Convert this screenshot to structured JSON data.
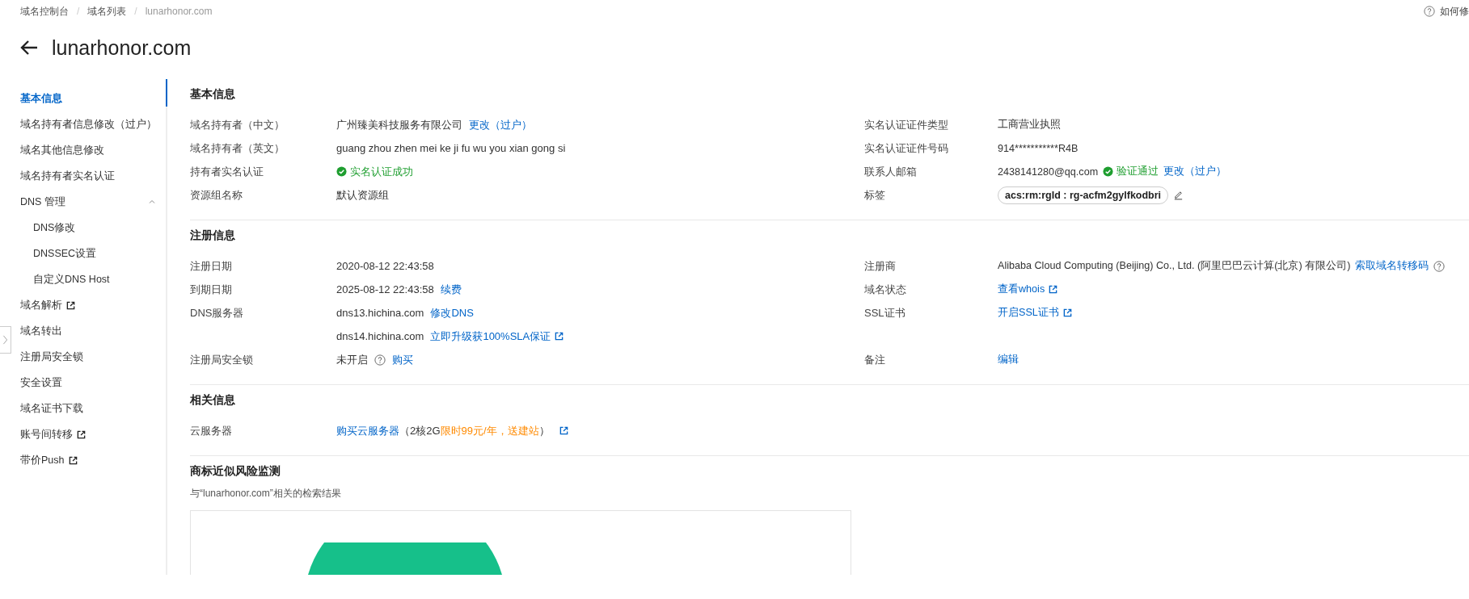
{
  "breadcrumb": [
    {
      "label": "域名控制台",
      "current": false
    },
    {
      "separator": "/",
      "label": "域名列表",
      "current": false
    },
    {
      "separator": "/",
      "label": "lunarhonor.com",
      "current": true
    }
  ],
  "help_link": "如何修",
  "title": "lunarhonor.com",
  "sidebar": {
    "items": [
      {
        "label": "基本信息",
        "selected": true
      },
      {
        "label": "域名持有者信息修改（过户）",
        "selected": false
      },
      {
        "label": "域名其他信息修改",
        "selected": false
      },
      {
        "label": "域名持有者实名认证",
        "selected": false
      },
      {
        "label": "DNS 管理",
        "selected": false,
        "expanded": true,
        "children": [
          {
            "label": "DNS修改",
            "selected": false
          },
          {
            "label": "DNSSEC设置",
            "selected": false
          },
          {
            "label": "自定义DNS Host",
            "selected": false
          }
        ]
      },
      {
        "label": "域名解析",
        "selected": false,
        "external": true
      },
      {
        "label": "域名转出",
        "selected": false
      },
      {
        "label": "注册局安全锁",
        "selected": false
      },
      {
        "label": "安全设置",
        "selected": false
      },
      {
        "label": "域名证书下载",
        "selected": false
      },
      {
        "label": "账号间转移",
        "selected": false,
        "external": true
      },
      {
        "label": "带价Push",
        "selected": false,
        "external": true
      }
    ]
  },
  "sections": [
    {
      "title": "基本信息",
      "rows": [
        {
          "left": {
            "label": "域名持有者（中文）",
            "lines": [
              [
                {
                  "kind": "text",
                  "text": "广州臻美科技服务有限公司"
                },
                {
                  "kind": "link",
                  "text": "更改（过户）"
                }
              ]
            ]
          },
          "right": {
            "label": "实名认证证件类型",
            "lines": [
              [
                {
                  "kind": "text",
                  "text": "工商营业执照"
                }
              ]
            ]
          }
        },
        {
          "left": {
            "label": "域名持有者（英文）",
            "lines": [
              [
                {
                  "kind": "text",
                  "text": "guang zhou zhen mei ke ji fu wu you xian gong si"
                }
              ]
            ]
          },
          "right": {
            "label": "实名认证证件号码",
            "lines": [
              [
                {
                  "kind": "text",
                  "text": "914***********R4B"
                }
              ]
            ]
          }
        },
        {
          "left": {
            "label": "持有者实名认证",
            "lines": [
              [
                {
                  "kind": "success",
                  "text": "实名认证成功"
                }
              ]
            ]
          },
          "right": {
            "label": "联系人邮箱",
            "lines": [
              [
                {
                  "kind": "text",
                  "text": "2438141280@qq.com"
                },
                {
                  "kind": "success",
                  "text": "验证通过"
                },
                {
                  "kind": "link",
                  "text": "更改（过户）"
                }
              ]
            ]
          }
        },
        {
          "left": {
            "label": "资源组名称",
            "lines": [
              [
                {
                  "kind": "text",
                  "text": "默认资源组"
                }
              ]
            ]
          },
          "right": {
            "label": "标签",
            "lines": [
              [
                {
                  "kind": "tag",
                  "text": "acs:rm:rgId : rg-acfm2gylfkodbri"
                },
                {
                  "kind": "edit"
                }
              ]
            ]
          }
        }
      ]
    },
    {
      "title": "注册信息",
      "rows": [
        {
          "left": {
            "label": "注册日期",
            "lines": [
              [
                {
                  "kind": "text",
                  "text": "2020-08-12 22:43:58"
                }
              ]
            ]
          },
          "right": {
            "label": "注册商",
            "lines": [
              [
                {
                  "kind": "text",
                  "text": "Alibaba Cloud Computing (Beijing) Co., Ltd. (阿里巴巴云计算(北京) 有限公司)"
                },
                {
                  "kind": "link",
                  "text": "索取域名转移码"
                },
                {
                  "kind": "help"
                }
              ]
            ]
          }
        },
        {
          "left": {
            "label": "到期日期",
            "lines": [
              [
                {
                  "kind": "text",
                  "text": "2025-08-12 22:43:58"
                },
                {
                  "kind": "link",
                  "text": "续费"
                }
              ]
            ]
          },
          "right": {
            "label": "域名状态",
            "lines": [
              [
                {
                  "kind": "link",
                  "text": "查看whois",
                  "external": true
                }
              ]
            ]
          }
        },
        {
          "left": {
            "label": "DNS服务器",
            "lines": [
              [
                {
                  "kind": "text",
                  "text": "dns13.hichina.com"
                },
                {
                  "kind": "link",
                  "text": "修改DNS"
                }
              ],
              [
                {
                  "kind": "text",
                  "text": "dns14.hichina.com"
                },
                {
                  "kind": "link",
                  "text": "立即升级获100%SLA保证",
                  "external": true
                }
              ]
            ]
          },
          "right": {
            "label": "SSL证书",
            "lines": [
              [
                {
                  "kind": "link",
                  "text": "开启SSL证书",
                  "external": true
                }
              ]
            ]
          }
        },
        {
          "left": {
            "label": "注册局安全锁",
            "lines": [
              [
                {
                  "kind": "text",
                  "text": "未开启"
                },
                {
                  "kind": "help"
                },
                {
                  "kind": "link",
                  "text": "购买"
                }
              ]
            ]
          },
          "right": {
            "label": "备注",
            "lines": [
              [
                {
                  "kind": "link",
                  "text": "编辑"
                }
              ]
            ]
          }
        }
      ]
    },
    {
      "title": "相关信息",
      "rows": [
        {
          "left": {
            "label": "云服务器",
            "lines": [
              [
                {
                  "kind": "link",
                  "text": "购买云服务器"
                },
                {
                  "kind": "promo",
                  "text": "（2核2G**限时99元/年，送建站**）"
                },
                {
                  "kind": "extlink"
                }
              ]
            ]
          }
        }
      ]
    }
  ],
  "trademark": {
    "title": "商标近似风险监测",
    "subtitle": "与“lunarhonor.com”相关的检索结果"
  }
}
